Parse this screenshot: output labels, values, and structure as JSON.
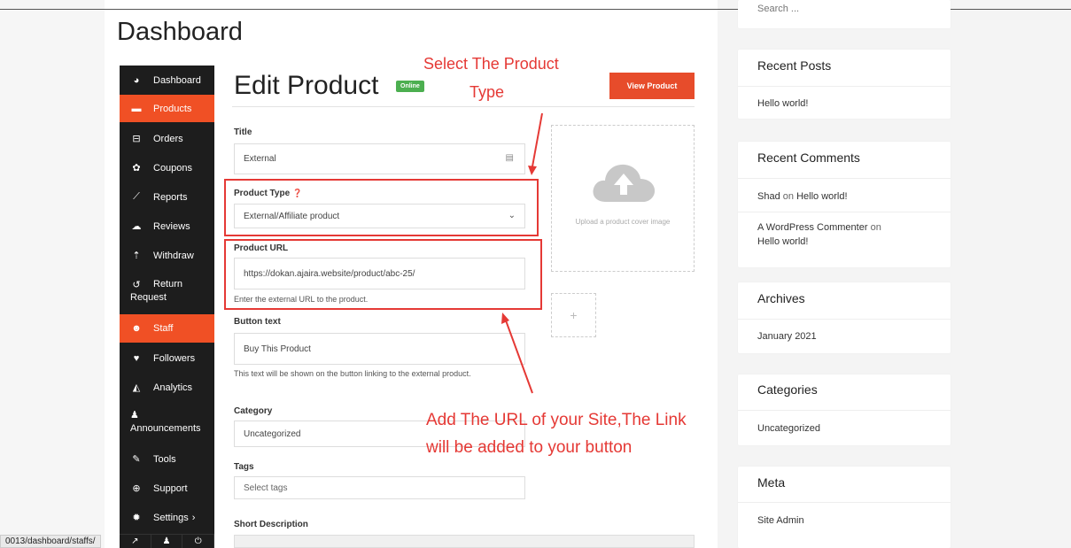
{
  "page": {
    "title": "Dashboard"
  },
  "menu": {
    "items": [
      {
        "label": "Dashboard",
        "icon": "dashboard-icon"
      },
      {
        "label": "Products",
        "icon": "briefcase-icon",
        "active": true
      },
      {
        "label": "Orders",
        "icon": "cart-icon"
      },
      {
        "label": "Coupons",
        "icon": "gift-icon"
      },
      {
        "label": "Reports",
        "icon": "chart-line-icon"
      },
      {
        "label": "Reviews",
        "icon": "comments-icon"
      },
      {
        "label": "Withdraw",
        "icon": "upload-icon"
      },
      {
        "label": "Return",
        "label2": "Request",
        "icon": "undo-icon"
      },
      {
        "label": "Staff",
        "icon": "users-icon",
        "active": true
      },
      {
        "label": "Followers",
        "icon": "heart-icon"
      },
      {
        "label": "Analytics",
        "icon": "area-chart-icon"
      },
      {
        "label": "Announcements",
        "icon": "bell-icon"
      },
      {
        "label": "Tools",
        "icon": "wrench-icon"
      },
      {
        "label": "Support",
        "icon": "lifebuoy-icon"
      },
      {
        "label": "Settings",
        "suffix": "›",
        "icon": "gear-icon"
      }
    ],
    "bottom": {
      "external": "↗",
      "user": "♟",
      "power": "⏻"
    }
  },
  "product": {
    "heading": "Edit Product",
    "badge": "Online",
    "view_button": "View Product",
    "title_label": "Title",
    "title_value": "External",
    "type_label": "Product Type",
    "type_value": "External/Affiliate product",
    "url_label": "Product URL",
    "url_value": "https://dokan.ajaira.website/product/abc-25/",
    "url_help": "Enter the external URL to the product.",
    "button_text_label": "Button text",
    "button_text_value": "Buy This Product",
    "button_text_help": "This text will be shown on the button linking to the external product.",
    "category_label": "Category",
    "category_value": "Uncategorized",
    "tags_label": "Tags",
    "tags_placeholder": "Select tags",
    "short_desc_label": "Short Description",
    "upload_text": "Upload a product cover image",
    "add_gallery": "+"
  },
  "annotations": {
    "select_type_line1": "Select The Product",
    "select_type_line2": "Type",
    "add_url_line1": "Add The URL of your Site,The Link",
    "add_url_line2": "will be added to your button",
    "color": "#e53935"
  },
  "statusbar": {
    "url": "0013/dashboard/staffs/"
  },
  "sidebar": {
    "search_placeholder": "Search ...",
    "recent_posts": {
      "title": "Recent Posts",
      "items": [
        "Hello world!"
      ]
    },
    "recent_comments": {
      "title": "Recent Comments",
      "c1_author": "Shad",
      "c1_on": "on",
      "c1_post": "Hello world!",
      "c2_author": "A WordPress Commenter",
      "c2_on": "on",
      "c2_post": "Hello world!"
    },
    "archives": {
      "title": "Archives",
      "items": [
        "January 2021"
      ]
    },
    "categories": {
      "title": "Categories",
      "items": [
        "Uncategorized"
      ]
    },
    "meta": {
      "title": "Meta",
      "items": [
        "Site Admin"
      ]
    }
  },
  "colors": {
    "accent": "#f05025",
    "menu_bg": "#1d1d1d",
    "badge": "#4caf50"
  }
}
